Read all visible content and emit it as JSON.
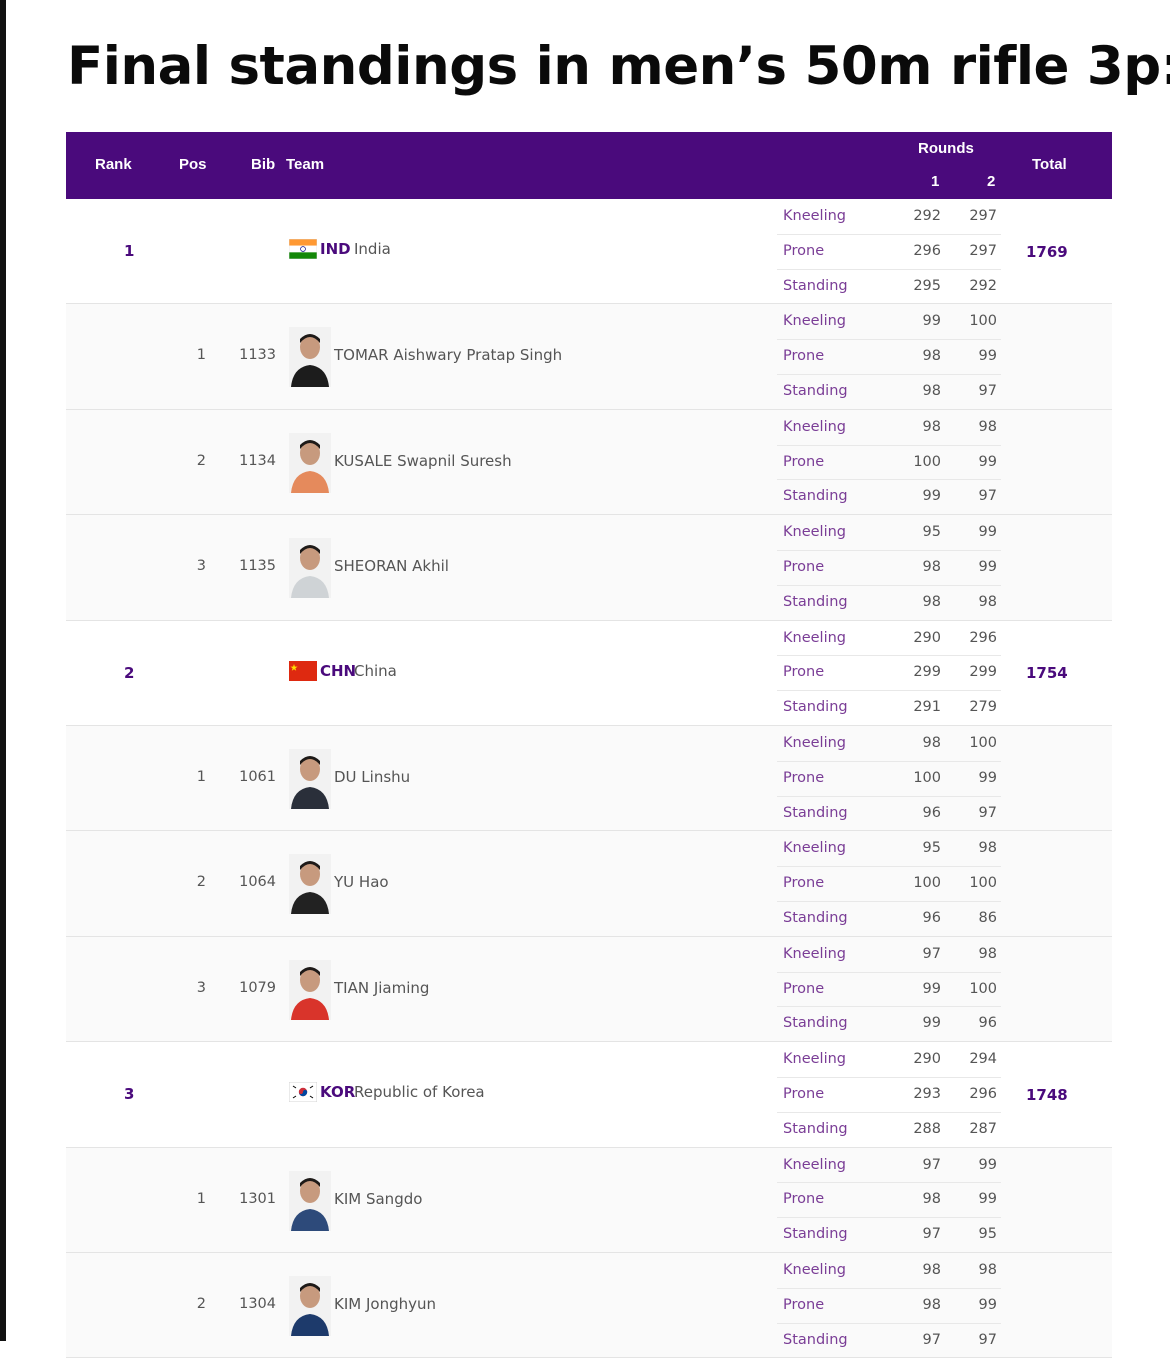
{
  "title": "Final standings in men’s 50m rifle 3p:",
  "header": {
    "rank": "Rank",
    "pos": "Pos",
    "bib": "Bib",
    "team": "Team",
    "rounds": "Rounds",
    "round1": "1",
    "round2": "2",
    "total": "Total"
  },
  "positions": [
    "Kneeling",
    "Prone",
    "Standing"
  ],
  "colors": {
    "header_bg": "#4a0a7c",
    "accent_text": "#4a0a7c",
    "position_text": "#7a3d96"
  },
  "teams": [
    {
      "rank": "1",
      "noc": "IND",
      "country": "India",
      "flag": "india-flag",
      "total": "1769",
      "scores": [
        [
          "292",
          "297"
        ],
        [
          "296",
          "297"
        ],
        [
          "295",
          "292"
        ]
      ],
      "athletes": [
        {
          "pos": "1",
          "bib": "1133",
          "name": "TOMAR Aishwary Pratap Singh",
          "scores": [
            [
              "99",
              "100"
            ],
            [
              "98",
              "99"
            ],
            [
              "98",
              "97"
            ]
          ]
        },
        {
          "pos": "2",
          "bib": "1134",
          "name": "KUSALE Swapnil Suresh",
          "scores": [
            [
              "98",
              "98"
            ],
            [
              "100",
              "99"
            ],
            [
              "99",
              "97"
            ]
          ]
        },
        {
          "pos": "3",
          "bib": "1135",
          "name": "SHEORAN Akhil",
          "scores": [
            [
              "95",
              "99"
            ],
            [
              "98",
              "99"
            ],
            [
              "98",
              "98"
            ]
          ]
        }
      ]
    },
    {
      "rank": "2",
      "noc": "CHN",
      "country": "China",
      "flag": "china-flag",
      "total": "1754",
      "scores": [
        [
          "290",
          "296"
        ],
        [
          "299",
          "299"
        ],
        [
          "291",
          "279"
        ]
      ],
      "athletes": [
        {
          "pos": "1",
          "bib": "1061",
          "name": "DU Linshu",
          "scores": [
            [
              "98",
              "100"
            ],
            [
              "100",
              "99"
            ],
            [
              "96",
              "97"
            ]
          ]
        },
        {
          "pos": "2",
          "bib": "1064",
          "name": "YU Hao",
          "scores": [
            [
              "95",
              "98"
            ],
            [
              "100",
              "100"
            ],
            [
              "96",
              "86"
            ]
          ]
        },
        {
          "pos": "3",
          "bib": "1079",
          "name": "TIAN Jiaming",
          "scores": [
            [
              "97",
              "98"
            ],
            [
              "99",
              "100"
            ],
            [
              "99",
              "96"
            ]
          ]
        }
      ]
    },
    {
      "rank": "3",
      "noc": "KOR",
      "country": "Republic of Korea",
      "flag": "korea-flag",
      "total": "1748",
      "scores": [
        [
          "290",
          "294"
        ],
        [
          "293",
          "296"
        ],
        [
          "288",
          "287"
        ]
      ],
      "athletes": [
        {
          "pos": "1",
          "bib": "1301",
          "name": "KIM Sangdo",
          "scores": [
            [
              "97",
              "99"
            ],
            [
              "98",
              "99"
            ],
            [
              "97",
              "95"
            ]
          ]
        },
        {
          "pos": "2",
          "bib": "1304",
          "name": "KIM Jonghyun",
          "scores": [
            [
              "98",
              "98"
            ],
            [
              "98",
              "99"
            ],
            [
              "97",
              "97"
            ]
          ]
        }
      ]
    }
  ]
}
